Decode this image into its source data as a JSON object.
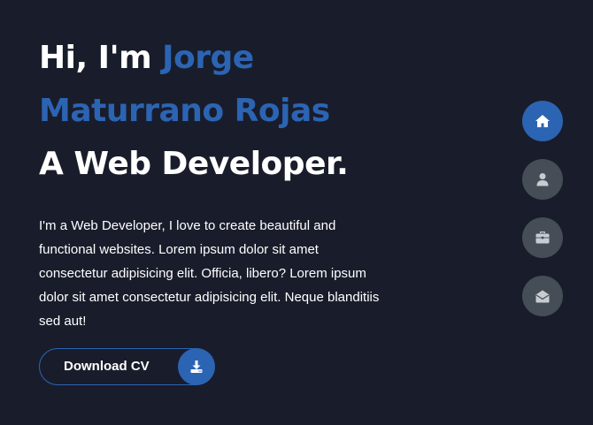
{
  "hero": {
    "greeting": "Hi, I'm ",
    "name_line1": "Jorge",
    "name_line2": "Maturrano Rojas",
    "role": "A Web Developer.",
    "bio": "I'm a Web Developer, I love to create beautiful and functional websites. Lorem ipsum dolor sit amet consectetur adipisicing elit. Officia, libero? Lorem ipsum dolor sit amet consectetur adipisicing elit. Neque blanditiis sed aut!"
  },
  "cv_button": {
    "label": "Download CV",
    "icon": "download-icon"
  },
  "nav": {
    "items": [
      {
        "icon": "home-icon",
        "active": true
      },
      {
        "icon": "user-icon",
        "active": false
      },
      {
        "icon": "briefcase-icon",
        "active": false
      },
      {
        "icon": "envelope-open-icon",
        "active": false
      }
    ]
  },
  "colors": {
    "background": "#191d2b",
    "accent": "#2c64b4",
    "nav_inactive": "#454e56",
    "text": "#ffffff"
  }
}
